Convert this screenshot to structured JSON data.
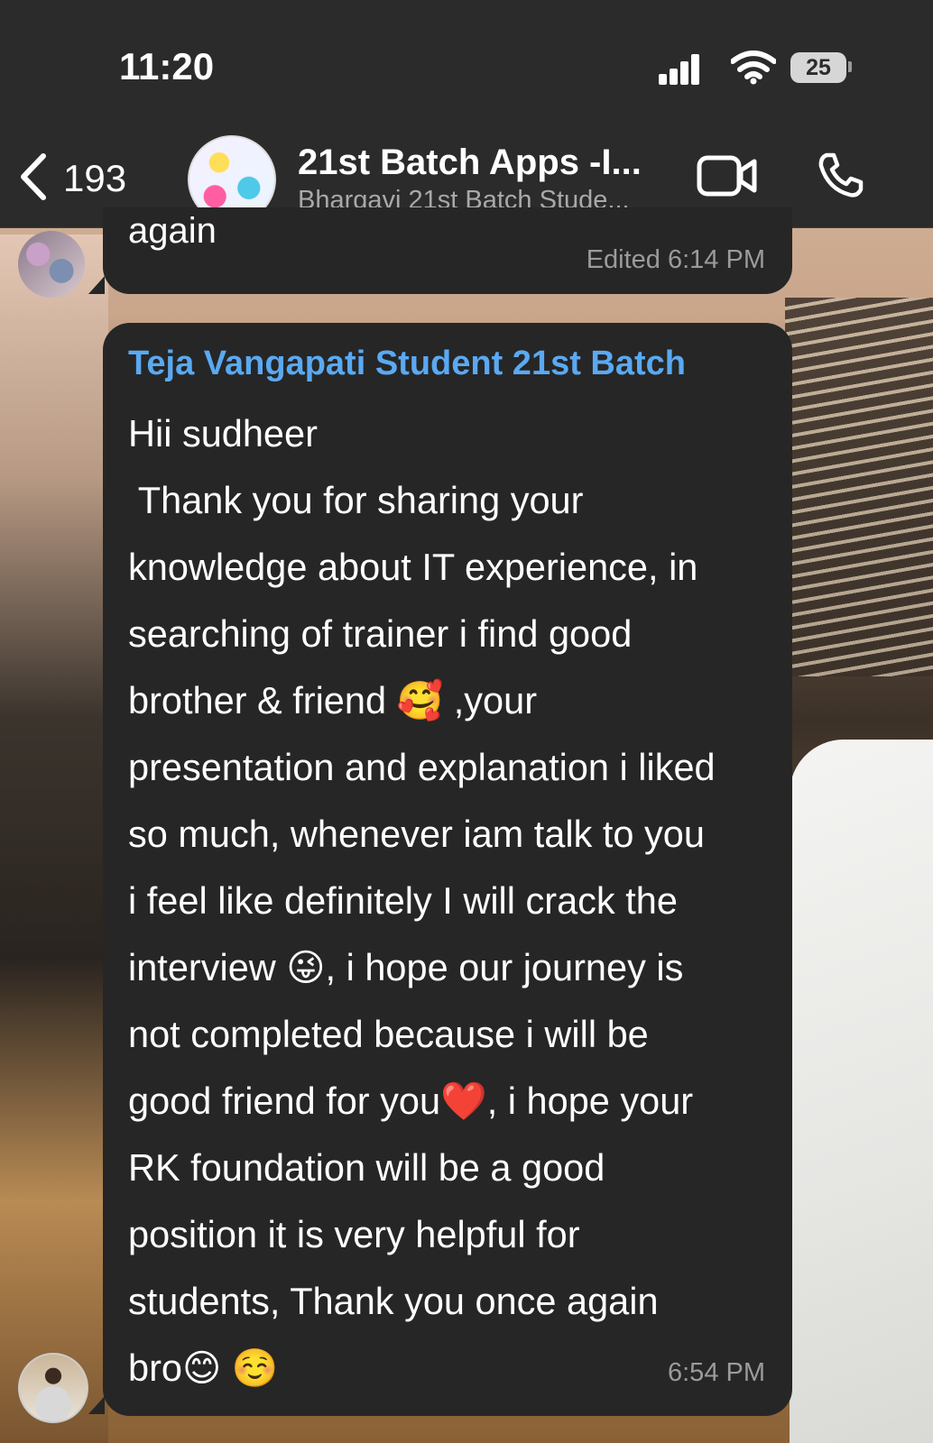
{
  "status_bar": {
    "time": "11:20",
    "battery": "25"
  },
  "header": {
    "back_count": "193",
    "group_title": "21st Batch Apps -I...",
    "group_subtitle": "Bhargavi 21st Batch Stude..."
  },
  "messages": [
    {
      "text": "again",
      "meta": "Edited 6:14 PM"
    },
    {
      "sender": "Teja Vangapati Student 21st Batch",
      "lines": [
        "Hii sudheer",
        " Thank you for sharing your",
        "knowledge about IT experience, in",
        "searching of trainer i find good",
        "brother & friend 🥰 ,your",
        "presentation and explanation i liked",
        "so much, whenever iam talk to you",
        "i feel like definitely I will crack the",
        "interview 😜, i hope our journey is",
        "not completed because i will be",
        "good friend for you❤️, i hope your",
        "RK foundation will be a good",
        "position it is very helpful for",
        "students, Thank you once again",
        "bro😊 ☺️"
      ],
      "time": "6:54 PM"
    }
  ],
  "colors": {
    "header_bg": "#2b2b2b",
    "bubble_bg": "#262626",
    "sender_name": "#5aa9f2",
    "meta_text": "#9b9b9b"
  },
  "icons": {
    "back": "chevron-left-icon",
    "video": "video-camera-icon",
    "call": "phone-icon",
    "wifi": "wifi-icon",
    "signal": "cellular-signal-icon",
    "battery": "battery-icon"
  }
}
